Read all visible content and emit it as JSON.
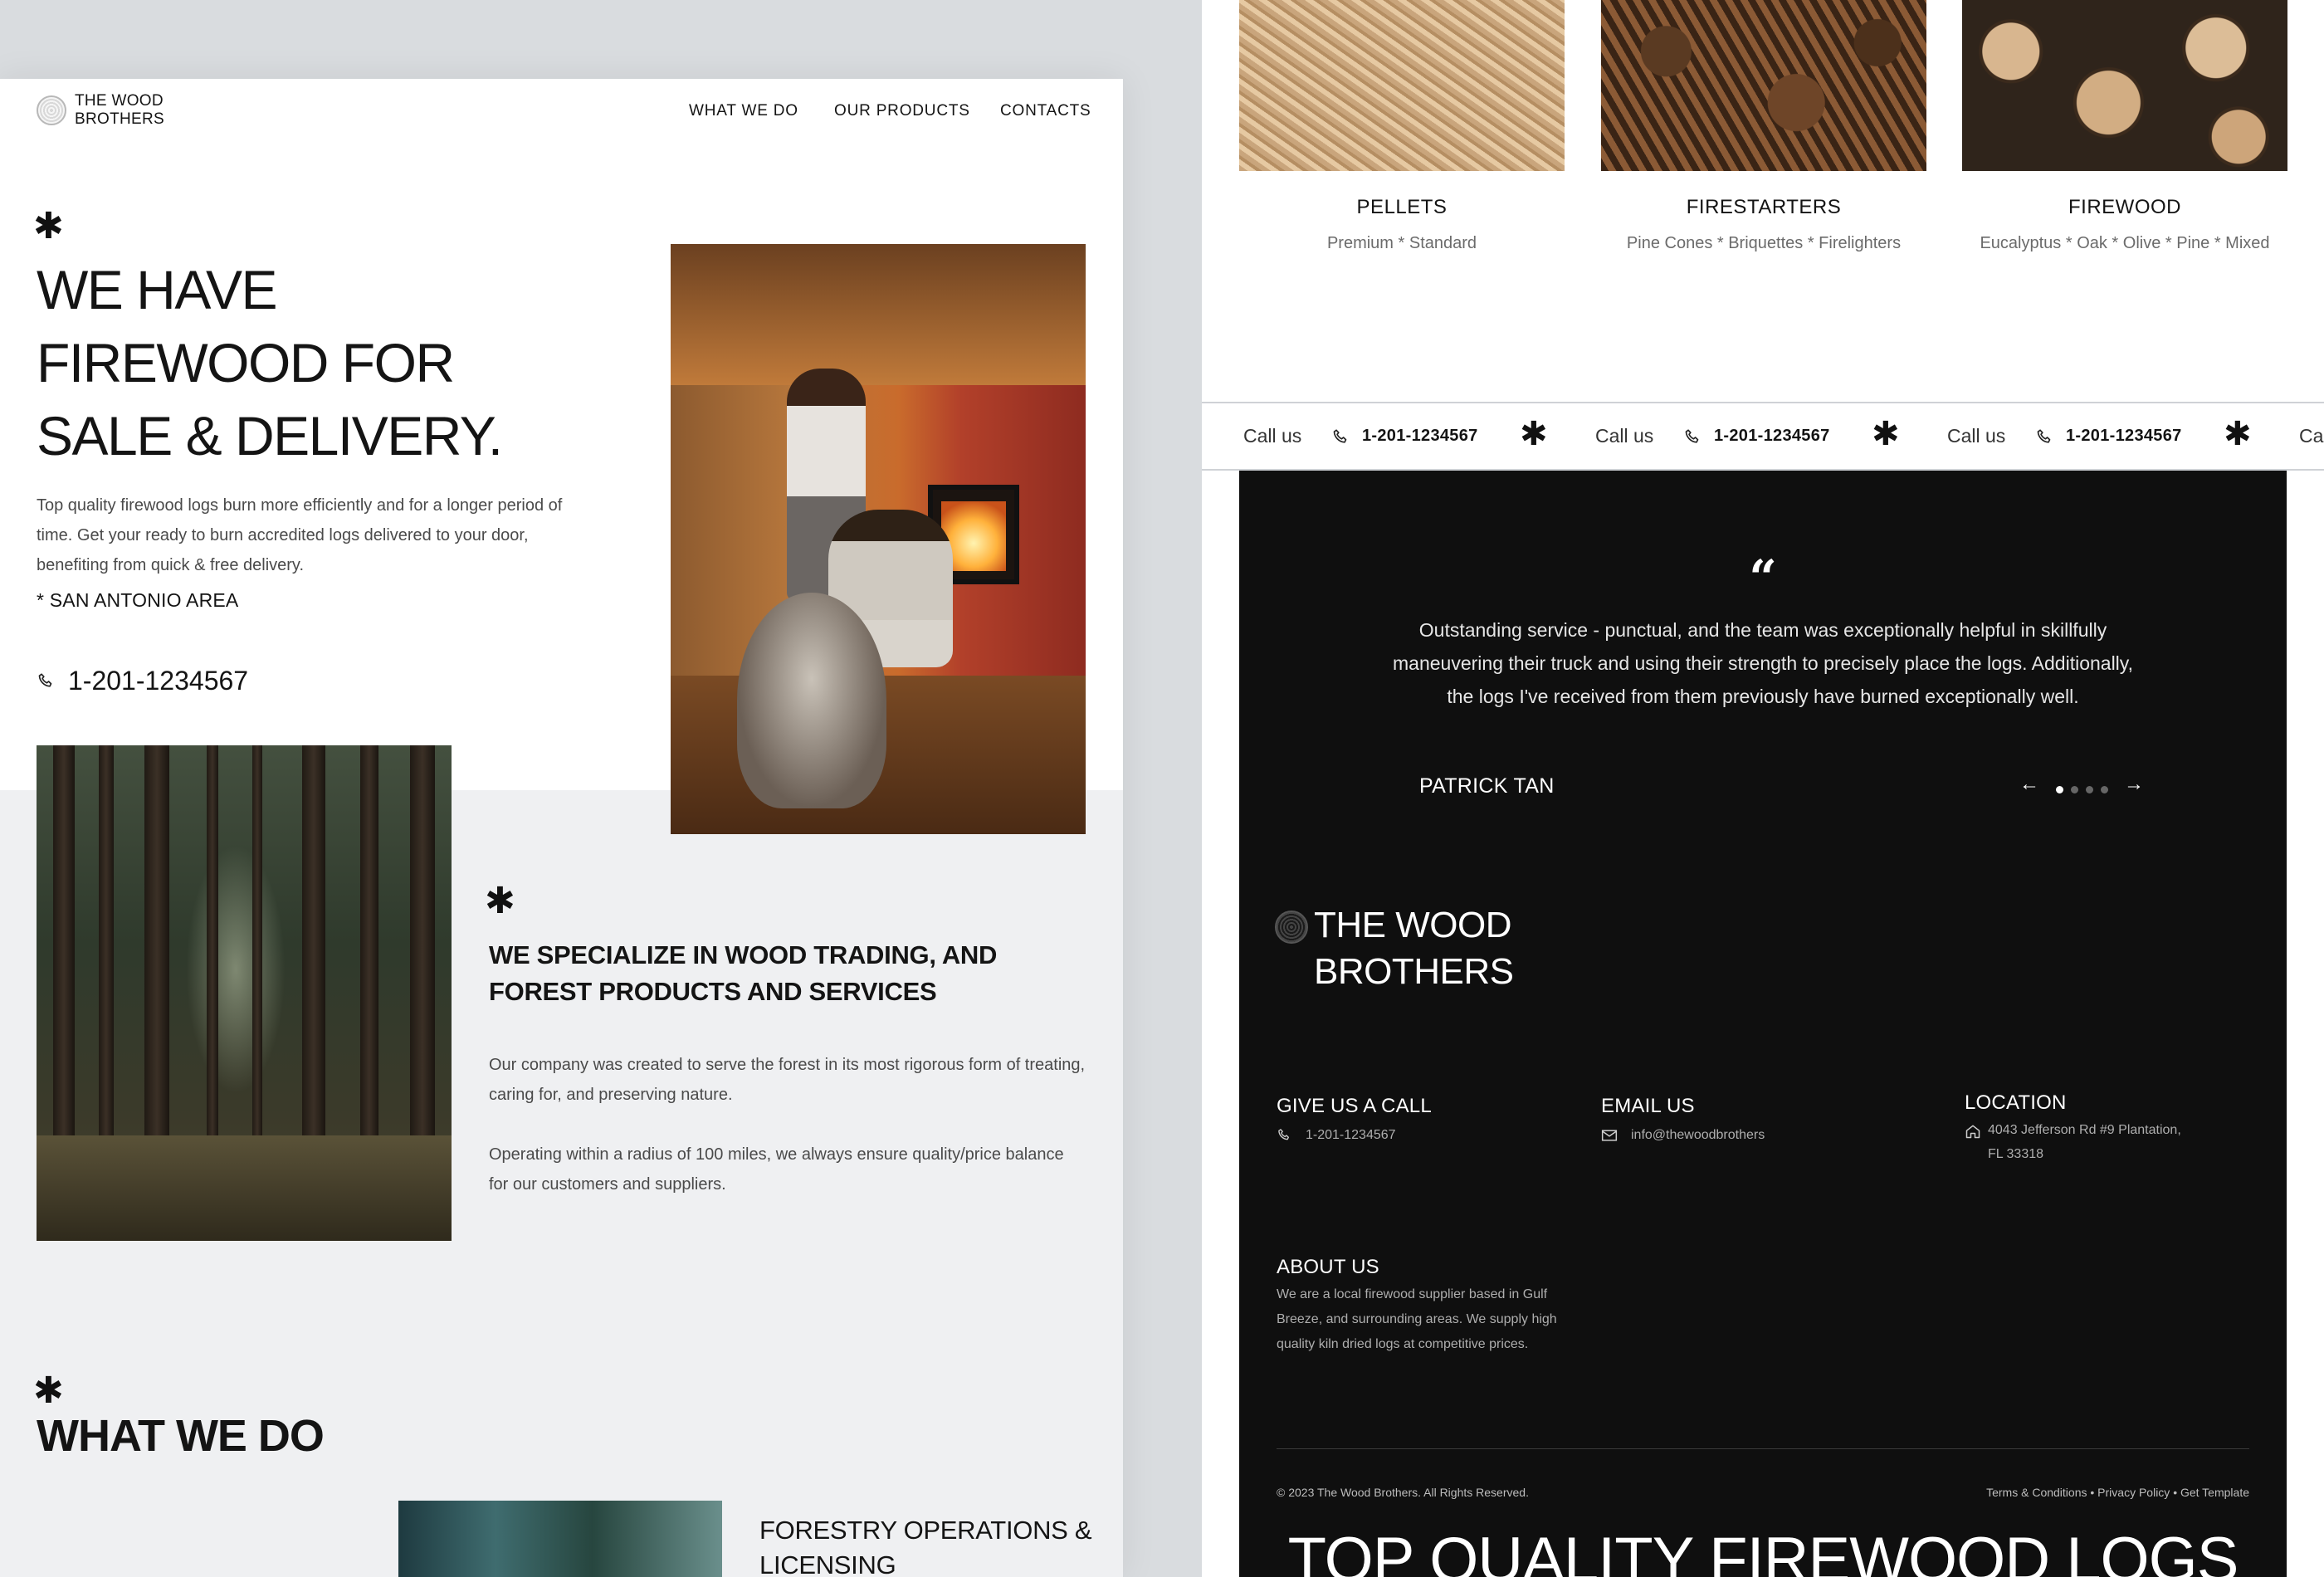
{
  "left": {
    "brand": {
      "line1": "THE WOOD",
      "line2": "BROTHERS"
    },
    "nav": [
      "WHAT WE DO",
      "OUR PRODUCTS",
      "CONTACTS"
    ],
    "hero": {
      "title_lines": [
        "WE HAVE",
        "FIREWOOD FOR",
        "SALE & DELIVERY."
      ],
      "description": "Top quality firewood logs burn more efficiently and for a longer period of time. Get your ready to burn accredited logs delivered to your door, benefiting from quick & free delivery.",
      "area": "* SAN ANTONIO AREA",
      "phone": "1-201-1234567"
    },
    "specialize": {
      "title": "WE SPECIALIZE IN WOOD TRADING, AND FOREST PRODUCTS AND SERVICES",
      "p1": "Our company was created to serve the forest in its most rigorous form of treating, caring for, and preserving nature.",
      "p2": "Operating within a radius of 100 miles, we always ensure quality/price balance for our customers and suppliers."
    },
    "what_we_do": {
      "title": "WHAT WE DO",
      "item_title": "FORESTRY OPERATIONS & LICENSING"
    }
  },
  "right": {
    "products": [
      {
        "name": "PELLETS",
        "sub": "Premium * Standard"
      },
      {
        "name": "FIRESTARTERS",
        "sub": "Pine Cones * Briquettes * Firelighters"
      },
      {
        "name": "FIREWOOD",
        "sub": "Eucalyptus * Oak * Olive * Pine * Mixed"
      }
    ],
    "ticker": {
      "call": "Call us",
      "phone": "1-201-1234567",
      "tail": "Ca"
    },
    "testimonial": {
      "quote_mark": "“",
      "text": "Outstanding service - punctual, and the team was exceptionally helpful in skillfully maneuvering their truck and using their strength to precisely place the logs. Additionally, the logs I've received from them previously have burned exceptionally well.",
      "author": "PATRICK TAN",
      "prev": "←",
      "next": "→",
      "active_index": 0,
      "total": 4
    },
    "footer": {
      "brand_line1": "THE WOOD",
      "brand_line2": "BROTHERS",
      "call_head": "GIVE US  A CALL",
      "call_value": "1-201-1234567",
      "email_head": "EMAIL US",
      "email_value": "info@thewoodbrothers",
      "location_head": "LOCATION",
      "location_line1": "4043 Jefferson Rd #9 Plantation,",
      "location_line2": "FL 33318",
      "about_head": "ABOUT US",
      "about_text": "We are a local firewood supplier based in Gulf Breeze, and surrounding areas. We supply high quality kiln dried logs at competitive prices.",
      "copyright": "© 2023 The Wood Brothers. All Rights Reserved.",
      "legal": "Terms & Conditions • Privacy Policy • Get Template",
      "tagline": "TOP QUALITY FIREWOOD LOGS"
    }
  },
  "icons": {
    "asterisk": "✱",
    "phone": "phone-icon",
    "mail": "mail-icon",
    "home": "home-icon"
  },
  "colors": {
    "dark_bg": "#0f0f0f",
    "light_bg": "#eff0f2",
    "text": "#141414"
  }
}
